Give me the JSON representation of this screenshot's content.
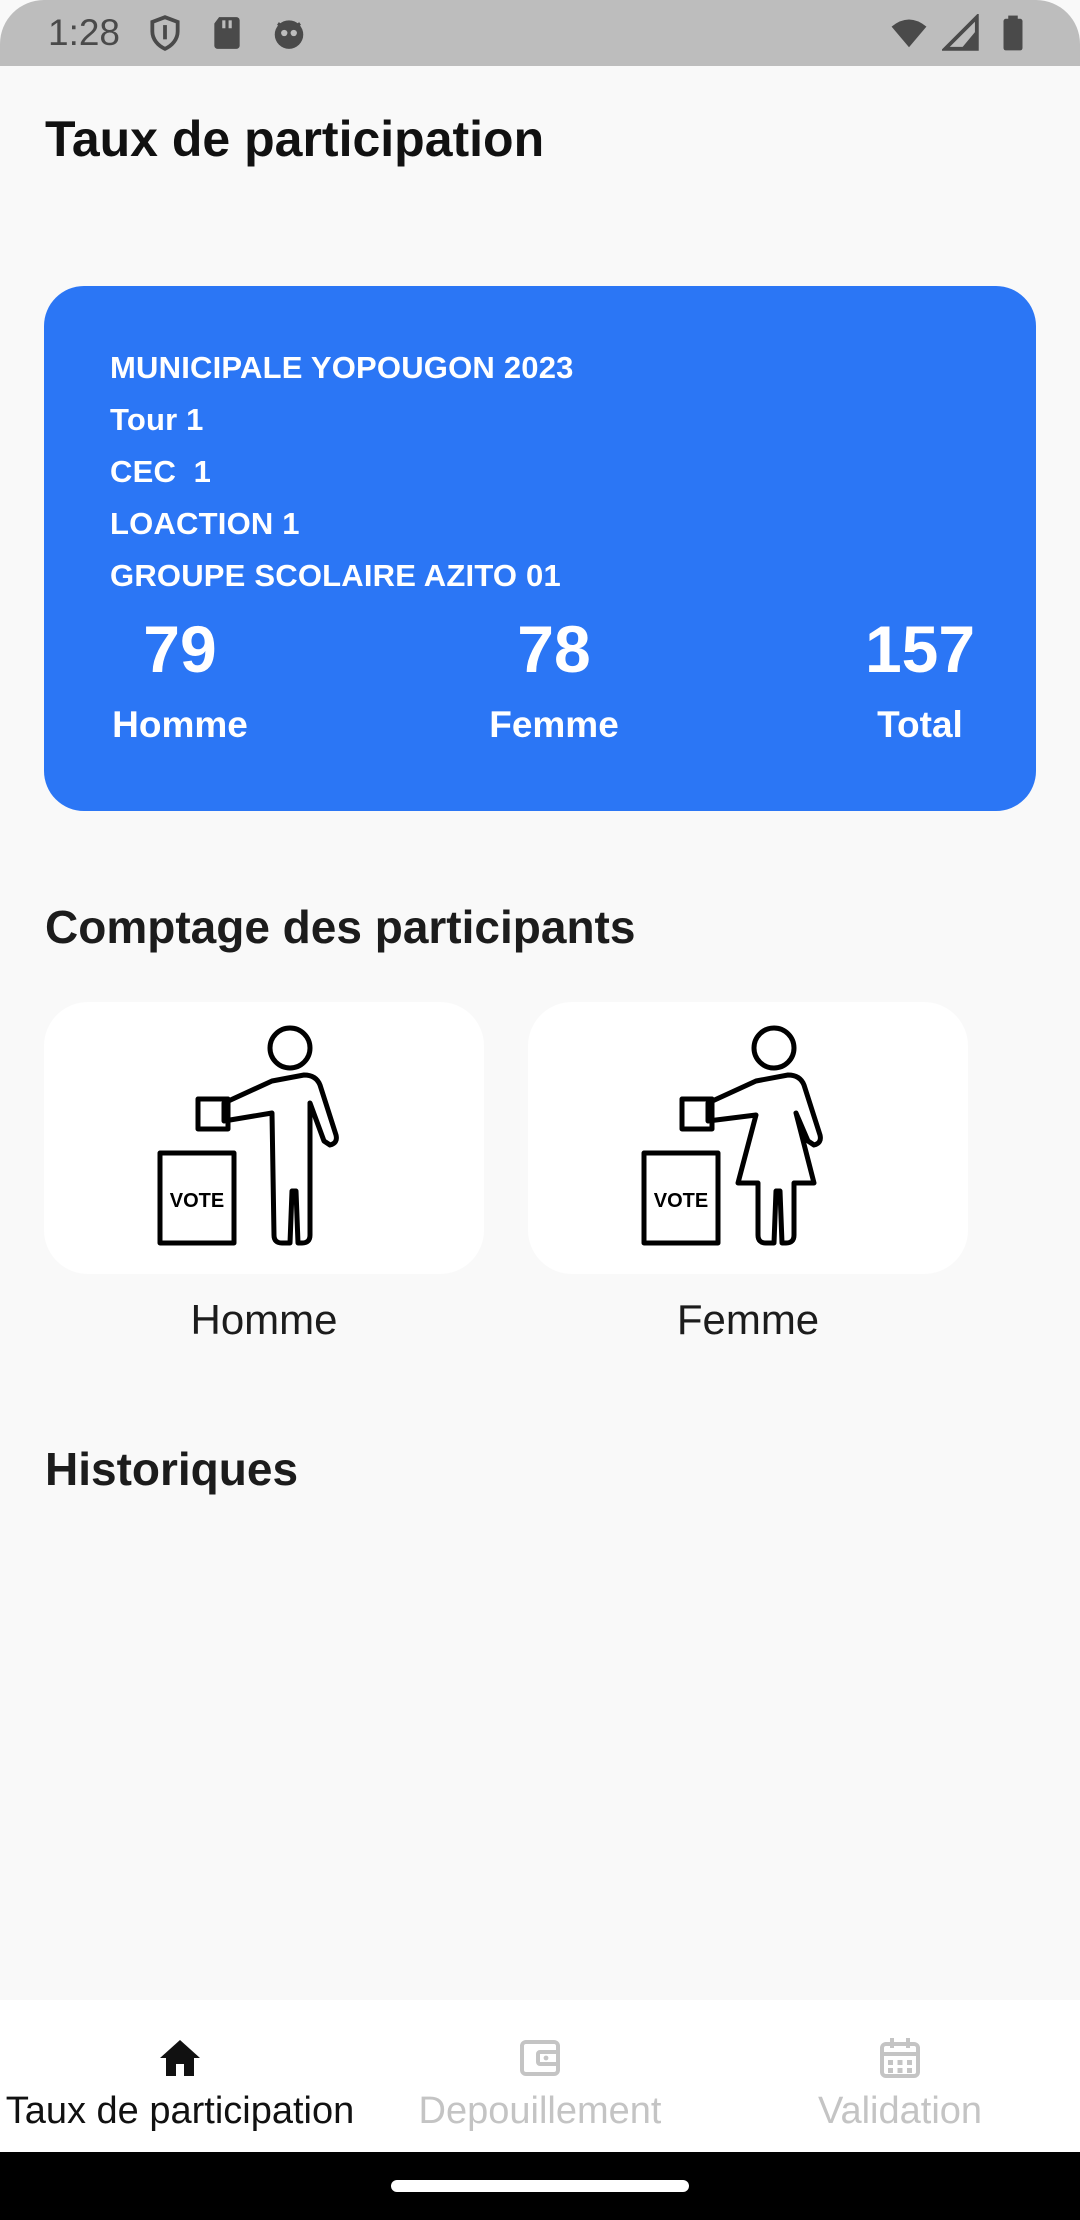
{
  "status_bar": {
    "time": "1:28",
    "left_icons": [
      "shield-icon",
      "sd-card-icon",
      "robot-face-icon"
    ],
    "right_icons": [
      "wifi-icon",
      "signal-icon",
      "battery-icon"
    ]
  },
  "header": {
    "title": "Taux de participation"
  },
  "card": {
    "background": "#2b76f5",
    "lines": [
      "MUNICIPALE YOPOUGON 2023",
      "Tour 1",
      "CEC  1",
      "LOACTION 1",
      "GROUPE SCOLAIRE AZITO 01"
    ],
    "stats": [
      {
        "value": "79",
        "label": "Homme"
      },
      {
        "value": "78",
        "label": "Femme"
      },
      {
        "value": "157",
        "label": "Total"
      }
    ]
  },
  "counting": {
    "title": "Comptage des participants",
    "tiles": [
      {
        "label": "Homme",
        "icon": "man-voting-icon",
        "box_text": "VOTE"
      },
      {
        "label": "Femme",
        "icon": "woman-voting-icon",
        "box_text": "VOTE"
      }
    ]
  },
  "history": {
    "title": "Historiques"
  },
  "bottom_nav": {
    "items": [
      {
        "label": "Taux de participation",
        "icon": "home-icon",
        "active": true
      },
      {
        "label": "Depouillement",
        "icon": "wallet-icon",
        "active": false
      },
      {
        "label": "Validation",
        "icon": "calendar-icon",
        "active": false
      }
    ]
  }
}
